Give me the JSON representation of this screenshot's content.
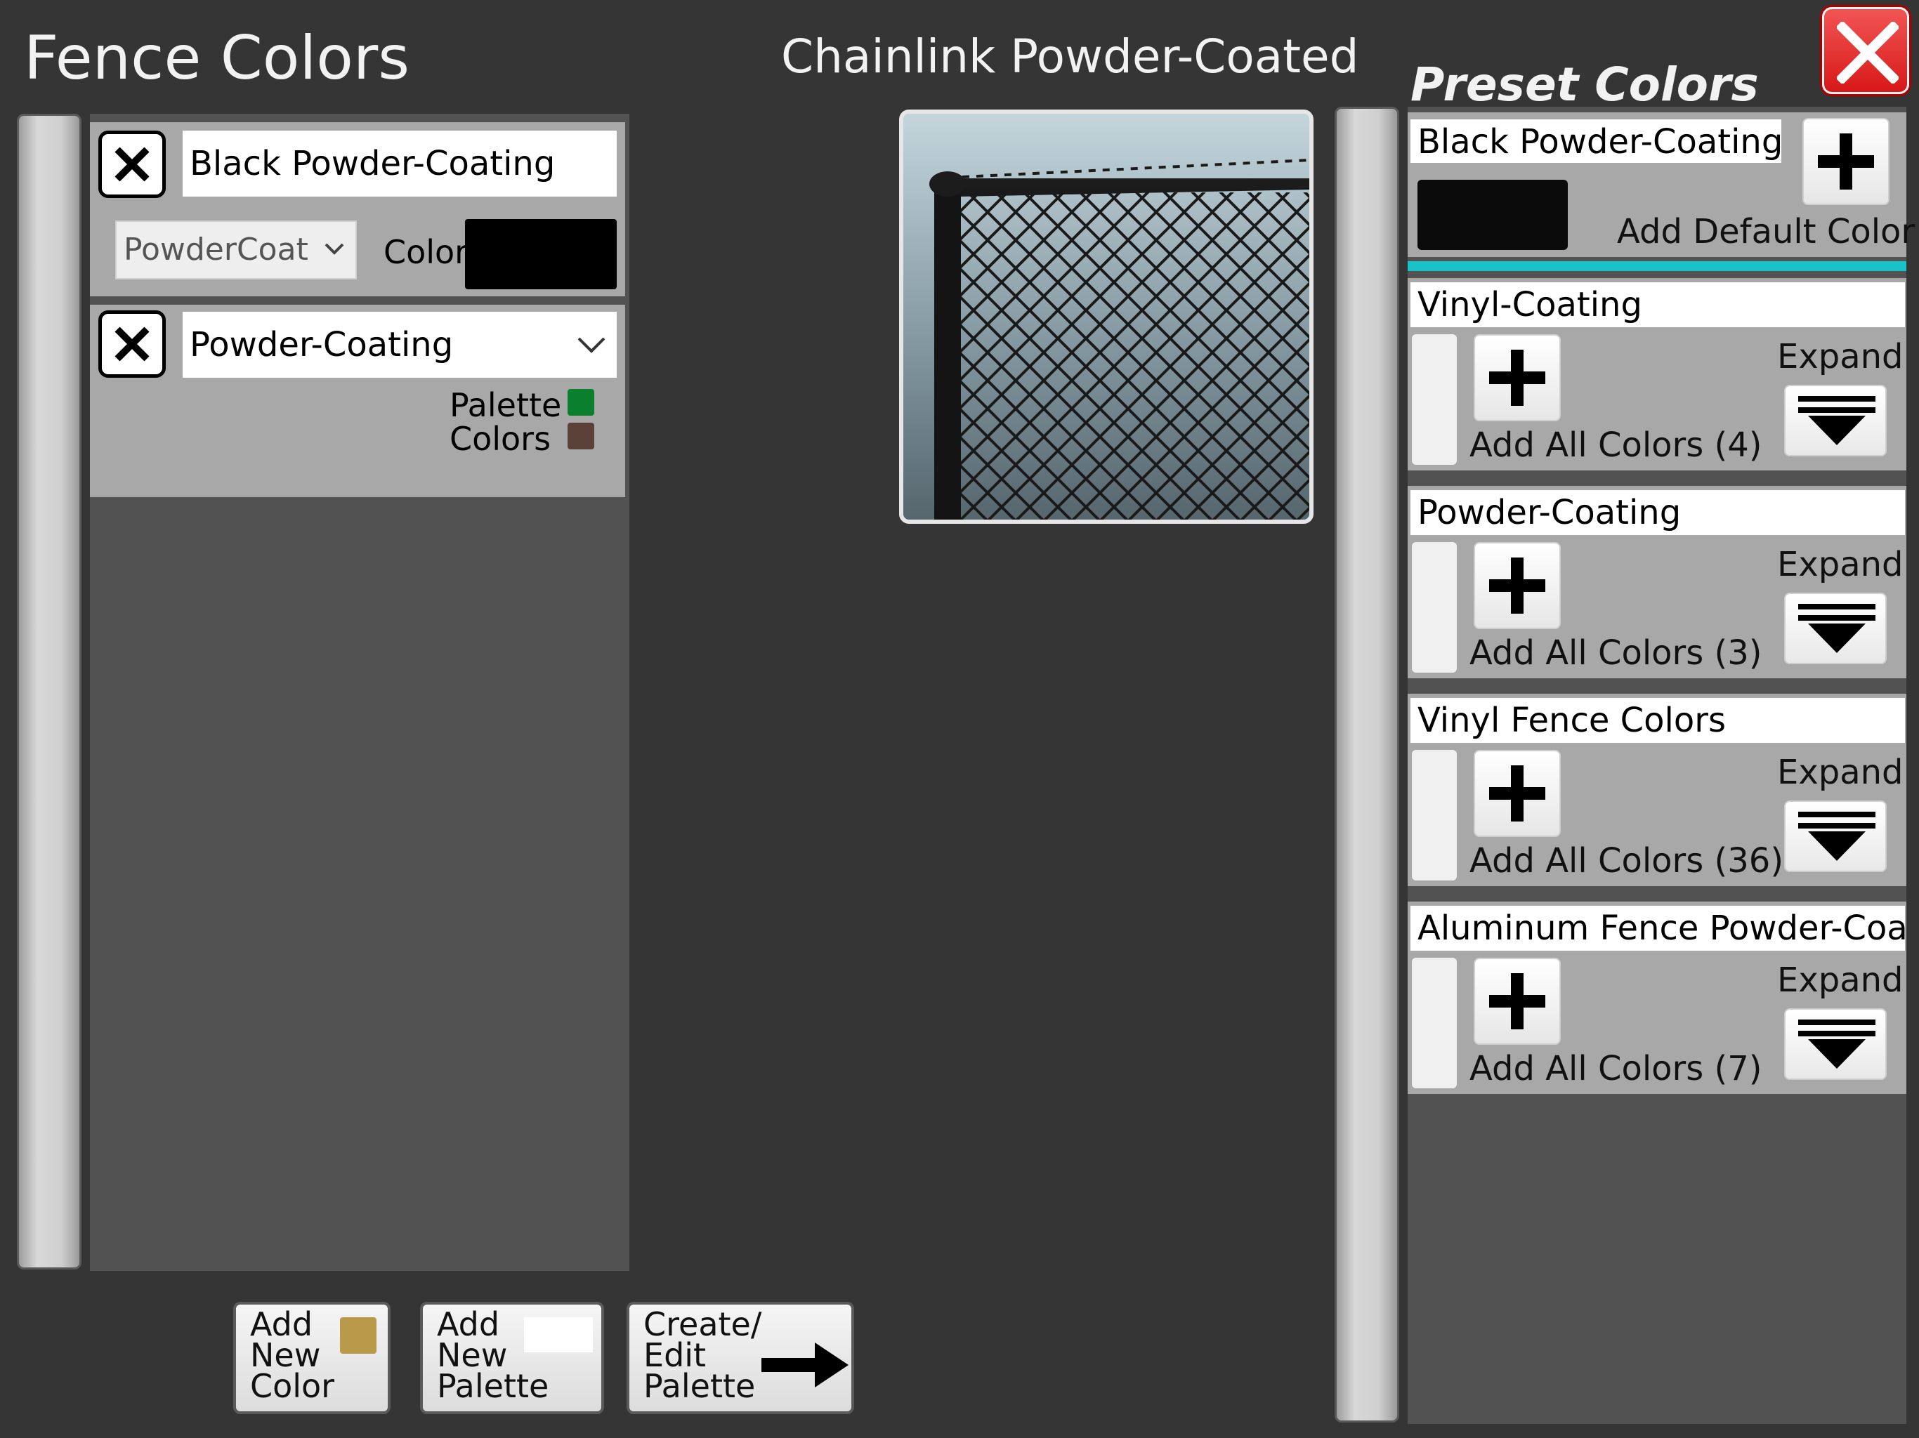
{
  "header": {
    "title": "Fence Colors",
    "preview_title": "Chainlink Powder-Coated",
    "preset_title": "Preset Colors"
  },
  "colors": {
    "accent_teal": "#19c2c6",
    "close_red": "#e02a2a"
  },
  "color_list": [
    {
      "type": "single",
      "name": "Black Powder-Coating",
      "material": "PowderCoat",
      "color_label": "Color",
      "swatch": "#000000"
    },
    {
      "type": "palette",
      "palette": "Powder-Coating",
      "label_line1": "Palette",
      "label_line2": "Colors",
      "swatches": [
        "#0a7f2e",
        "#5a4238"
      ]
    }
  ],
  "preset": {
    "default": {
      "name": "Black Powder-Coating",
      "swatch": "#0b0b0b",
      "add_label": "Add Default Color"
    },
    "groups": [
      {
        "name": "Vinyl-Coating",
        "add_label": "Add All Colors (4)",
        "expand_label": "Expand"
      },
      {
        "name": "Powder-Coating",
        "add_label": "Add All Colors (3)",
        "expand_label": "Expand"
      },
      {
        "name": "Vinyl Fence Colors",
        "add_label": "Add All Colors (36)",
        "expand_label": "Expand"
      },
      {
        "name": "Aluminum Fence Powder-Coat",
        "add_label": "Add All Colors (7)",
        "expand_label": "Expand"
      }
    ]
  },
  "bottom_buttons": {
    "add_color": {
      "label": "Add\nNew\nColor",
      "swatch": "#b89a4a"
    },
    "add_palette": {
      "label": "Add\nNew\nPalette",
      "swatch": "#ffffff"
    },
    "edit_palette": {
      "label": "Create/\nEdit\nPalette"
    }
  }
}
